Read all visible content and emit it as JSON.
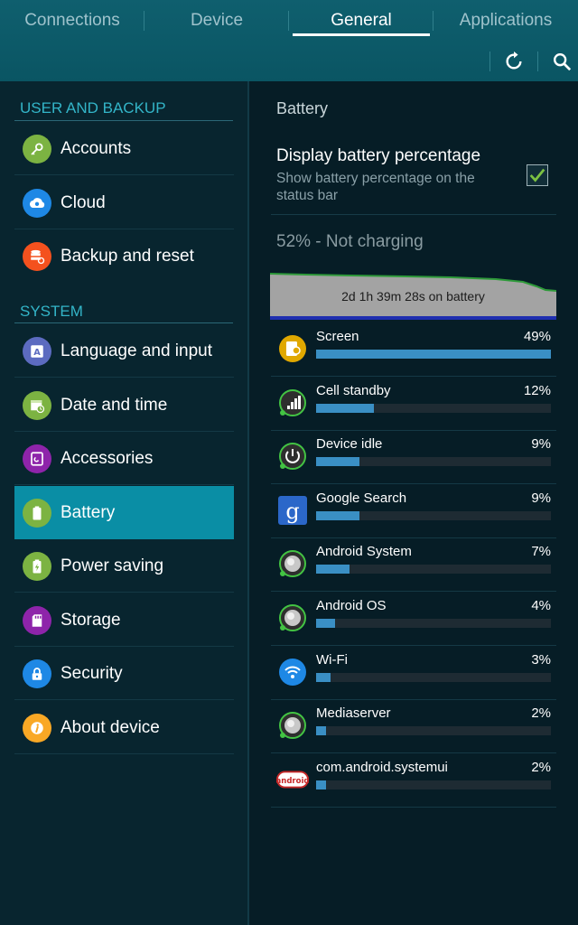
{
  "tabs": [
    {
      "label": "Connections",
      "active": false
    },
    {
      "label": "Device",
      "active": false
    },
    {
      "label": "General",
      "active": true
    },
    {
      "label": "Applications",
      "active": false
    }
  ],
  "toolbar": {
    "refresh_icon": "refresh-icon",
    "search_icon": "search-icon"
  },
  "sidebar": {
    "sections": [
      {
        "header": "USER AND BACKUP"
      },
      {
        "header": "SYSTEM"
      }
    ],
    "items": [
      {
        "label": "Accounts",
        "icon": "key-icon",
        "color": "#7cb342"
      },
      {
        "label": "Cloud",
        "icon": "cloud-icon",
        "color": "#1e88e5"
      },
      {
        "label": "Backup and reset",
        "icon": "backup-icon",
        "color": "#f4511e"
      },
      {
        "label": "Language and input",
        "icon": "keyboard-a-icon",
        "color": "#5c6bc0"
      },
      {
        "label": "Date and time",
        "icon": "calendar-icon",
        "color": "#7cb342"
      },
      {
        "label": "Accessories",
        "icon": "accessory-icon",
        "color": "#8e24aa"
      },
      {
        "label": "Battery",
        "icon": "battery-icon",
        "color": "#7cb342",
        "active": true
      },
      {
        "label": "Power saving",
        "icon": "power-saving-icon",
        "color": "#7cb342"
      },
      {
        "label": "Storage",
        "icon": "sd-card-icon",
        "color": "#8e24aa"
      },
      {
        "label": "Security",
        "icon": "lock-icon",
        "color": "#1e88e5"
      },
      {
        "label": "About device",
        "icon": "info-icon",
        "color": "#f9a825"
      }
    ]
  },
  "battery": {
    "title": "Battery",
    "display_percentage": {
      "title": "Display battery percentage",
      "description": "Show battery percentage on the status bar",
      "checked": true
    },
    "status": "52% - Not charging",
    "graph_label": "2d 1h 39m 28s on battery",
    "usage": [
      {
        "name": "Screen",
        "percent_text": "49%",
        "percent": 49,
        "icon": "screen-brightness-icon"
      },
      {
        "name": "Cell standby",
        "percent_text": "12%",
        "percent": 12,
        "icon": "cell-signal-icon"
      },
      {
        "name": "Device idle",
        "percent_text": "9%",
        "percent": 9,
        "icon": "power-icon"
      },
      {
        "name": "Google Search",
        "percent_text": "9%",
        "percent": 9,
        "icon": "google-g-icon"
      },
      {
        "name": "Android System",
        "percent_text": "7%",
        "percent": 7,
        "icon": "android-system-icon"
      },
      {
        "name": "Android OS",
        "percent_text": "4%",
        "percent": 4,
        "icon": "android-os-icon"
      },
      {
        "name": "Wi-Fi",
        "percent_text": "3%",
        "percent": 3,
        "icon": "wifi-icon"
      },
      {
        "name": "Mediaserver",
        "percent_text": "2%",
        "percent": 2,
        "icon": "mediaserver-icon"
      },
      {
        "name": "com.android.systemui",
        "percent_text": "2%",
        "percent": 2,
        "icon": "android-logo-icon"
      }
    ]
  }
}
